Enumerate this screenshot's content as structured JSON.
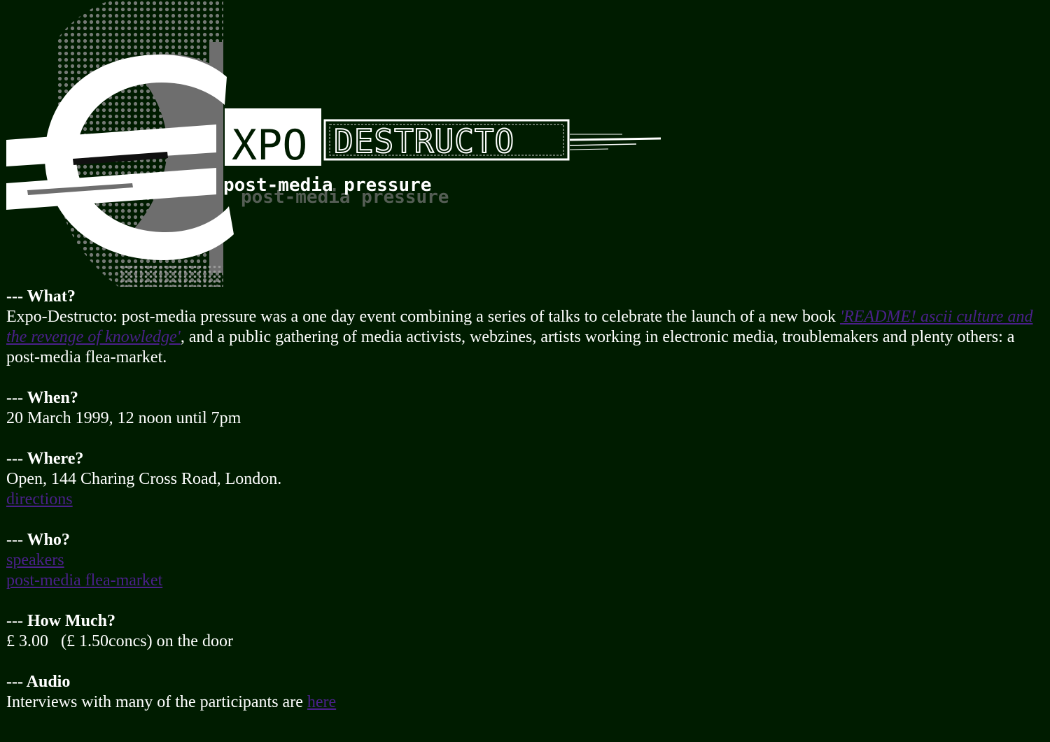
{
  "logo": {
    "symbol": "€",
    "word_1": "XPO",
    "word_2": "DESTRUCTO",
    "tagline": "post-media pressure",
    "colors": {
      "white": "#FFFFFF",
      "grey": "#7A7A7A",
      "background": "#001C00"
    }
  },
  "sections": {
    "what": {
      "heading": "--- What?",
      "text_before": "Expo-Destructo: post-media pressure was a one day event combining a series of talks to celebrate the launch of a new book ",
      "book_link": "'README! ascii culture and the revenge of knowledge'",
      "text_after": ", and a public gathering of media activists, webzines, artists working in electronic media, troublemakers and plenty others: a post-media flea-market."
    },
    "when": {
      "heading": "--- When?",
      "text": "20 March 1999, 12 noon until 7pm"
    },
    "where": {
      "heading": "--- Where?",
      "text": "Open, 144 Charing Cross Road, London.",
      "directions_link": "directions"
    },
    "who": {
      "heading": "--- Who?",
      "speakers_link": "speakers",
      "flea_market_link": "post-media flea-market"
    },
    "how_much": {
      "heading": "--- How Much?",
      "text": "£ 3.00   (£ 1.50concs) on the door"
    },
    "audio": {
      "heading": "--- Audio",
      "text": "Interviews with many of the participants are ",
      "here_link": "here"
    }
  },
  "colors": {
    "background": "#001C00",
    "text": "#FFFFFF",
    "link": "#4A208A"
  }
}
